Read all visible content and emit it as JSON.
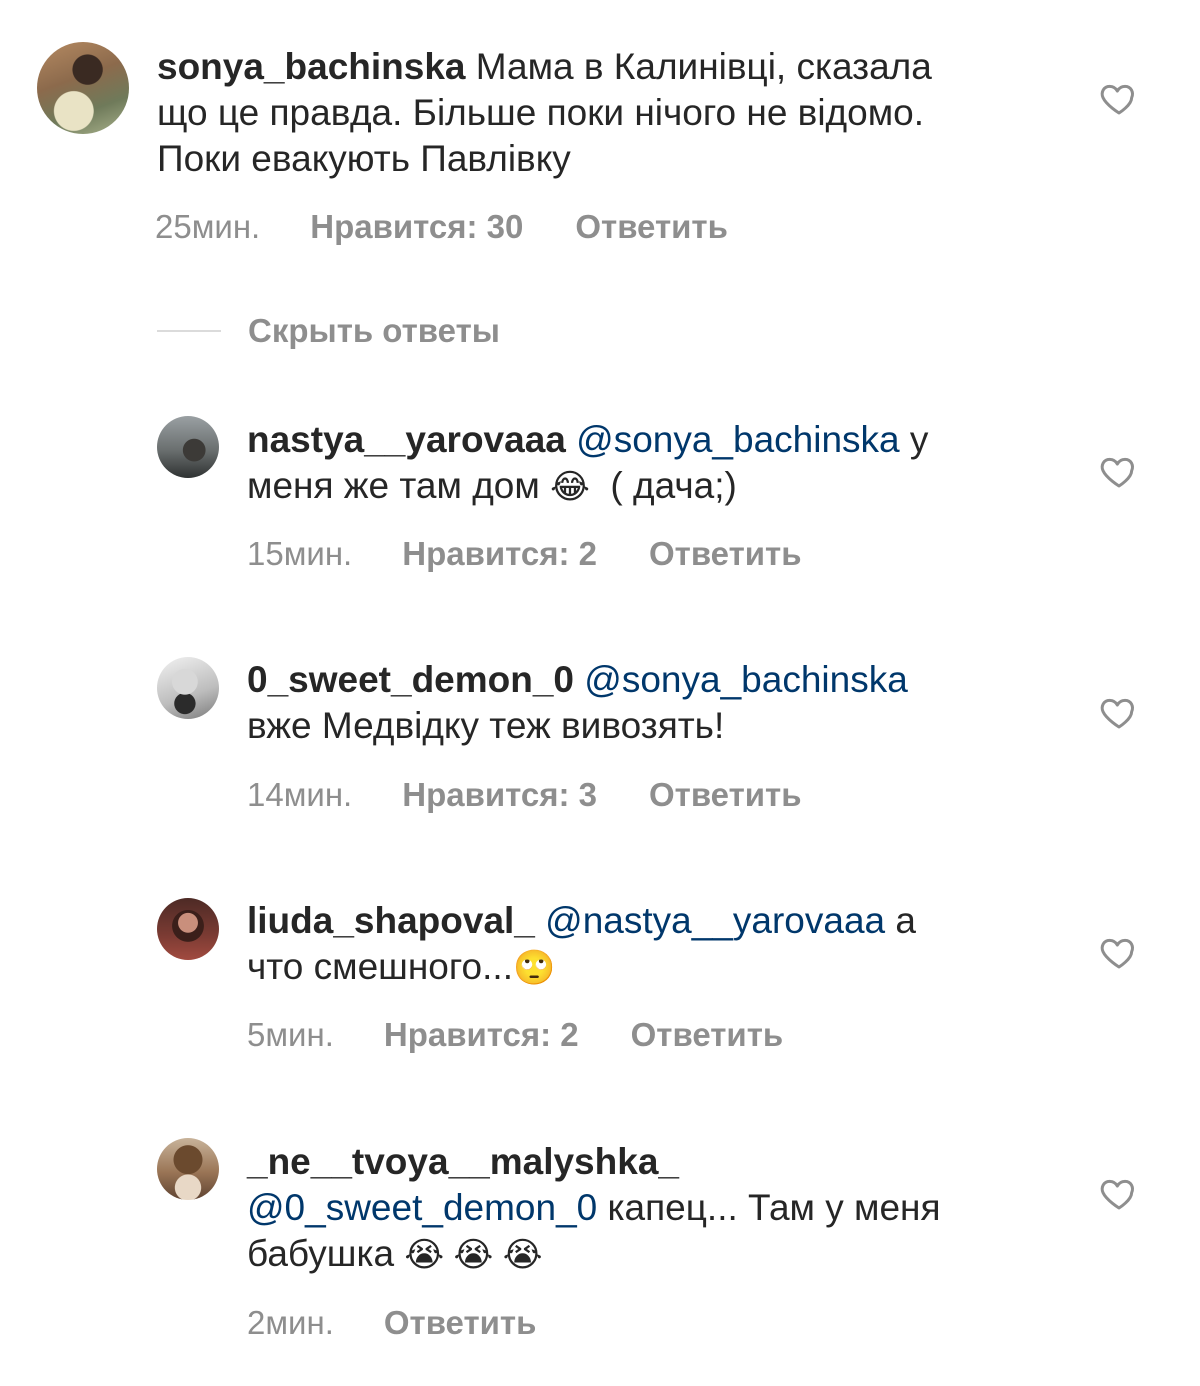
{
  "main_comment": {
    "username": "sonya_bachinska",
    "text_line1": " Мама в Калинівці, сказала",
    "text_line2": "що це правда. Більше поки нічого не відомо.",
    "text_line3": "Поки евакують Павлівку",
    "time": "25мин.",
    "likes": "Нравится: 30",
    "reply": "Ответить"
  },
  "hide_replies_label": "Скрыть ответы",
  "replies": [
    {
      "username": "nastya__yarovaaa",
      "mention": "@sonya_bachinska",
      "text_after_mention": " у",
      "text_line2": "меня же там дом ",
      "emoji": "😂",
      "text_line2_tail": "  ( дача;)",
      "time": "15мин.",
      "likes": "Нравится: 2",
      "reply": "Ответить"
    },
    {
      "username": "0_sweet_demon_0",
      "mention": "@sonya_bachinska",
      "text_line2": "вже Медвідку теж вивозять!",
      "time": "14мин.",
      "likes": "Нравится: 3",
      "reply": "Ответить"
    },
    {
      "username": "liuda_shapoval_",
      "mention": "@nastya__yarovaaa",
      "text_after_mention": " а",
      "text_line2": "что смешного...",
      "emoji": "🙄",
      "time": "5мин.",
      "likes": "Нравится: 2",
      "reply": "Ответить"
    },
    {
      "username": "_ne__tvoya__malyshka_",
      "mention": "@0_sweet_demon_0",
      "text_after_mention": " капец... Там у меня",
      "text_line3": "бабушка ",
      "emoji": "😭 😭 😭",
      "time": "2мин.",
      "reply": "Ответить"
    }
  ],
  "icons": {
    "like": "heart-outline-icon"
  },
  "colors": {
    "text": "#262626",
    "secondary": "#8e8e8e",
    "mention": "#00376b"
  }
}
